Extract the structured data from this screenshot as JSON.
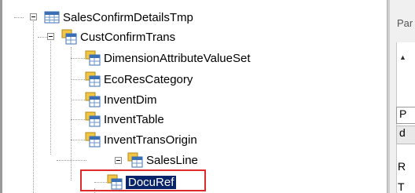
{
  "tree": {
    "root": {
      "label": "SalesConfirmDetailsTmp",
      "icon": "table-icon"
    },
    "child": {
      "label": "CustConfirmTrans",
      "icon": "datasource-icon"
    },
    "items": [
      {
        "label": "DimensionAttributeValueSet",
        "icon": "datasource-icon"
      },
      {
        "label": "EcoResCategory",
        "icon": "datasource-icon"
      },
      {
        "label": "InventDim",
        "icon": "datasource-icon"
      },
      {
        "label": "InventTable",
        "icon": "datasource-icon"
      },
      {
        "label": "InventTransOrigin",
        "icon": "datasource-icon"
      }
    ],
    "salesline": {
      "label": "SalesLine",
      "icon": "datasource-icon"
    },
    "docuref": {
      "label": "DocuRef",
      "icon": "datasource-icon",
      "selected": true
    }
  },
  "right_panel": {
    "label": "Par",
    "sort_glyph": "▲",
    "row_p": "P",
    "row_d": "d",
    "row_r": "R",
    "row_t": "T"
  },
  "colors": {
    "highlight_border": "#e02a2a",
    "selection": "#0a246a"
  }
}
